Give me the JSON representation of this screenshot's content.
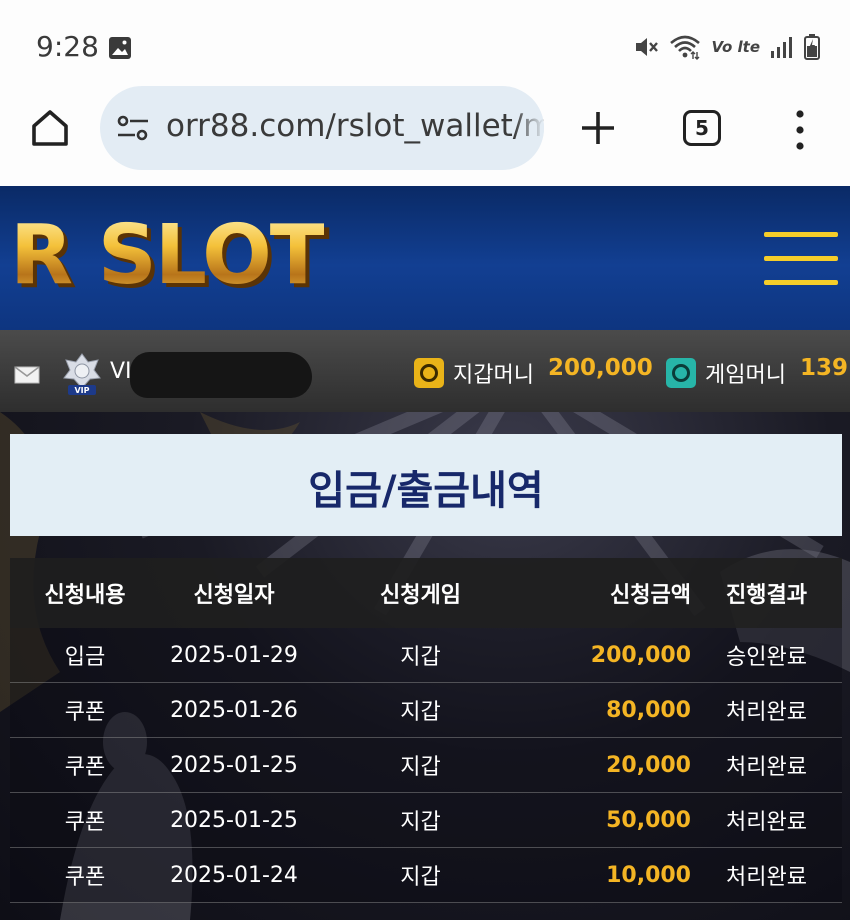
{
  "status_bar": {
    "time": "9:28",
    "lte_label": "Vo lte"
  },
  "browser": {
    "url": "orr88.com/rslot_wallet/m",
    "tab_count": "5"
  },
  "site": {
    "logo": "R SLOT"
  },
  "user": {
    "vip_prefix": "VI",
    "wallet_label": "지갑머니",
    "wallet_value": "200,000",
    "game_label": "게임머니",
    "game_value": "139"
  },
  "page": {
    "title": "입금/출금내역"
  },
  "table": {
    "headers": [
      "신청내용",
      "신청일자",
      "신청게임",
      "신청금액",
      "진행결과"
    ],
    "rows": [
      {
        "type": "입금",
        "date": "2025-01-29",
        "game": "지갑",
        "amount": "200,000",
        "result": "승인완료"
      },
      {
        "type": "쿠폰",
        "date": "2025-01-26",
        "game": "지갑",
        "amount": "80,000",
        "result": "처리완료"
      },
      {
        "type": "쿠폰",
        "date": "2025-01-25",
        "game": "지갑",
        "amount": "20,000",
        "result": "처리완료"
      },
      {
        "type": "쿠폰",
        "date": "2025-01-25",
        "game": "지갑",
        "amount": "50,000",
        "result": "처리완료"
      },
      {
        "type": "쿠폰",
        "date": "2025-01-24",
        "game": "지갑",
        "amount": "10,000",
        "result": "처리완료"
      }
    ]
  },
  "colors": {
    "header_blue": "#123f92",
    "gold": "#f4b524",
    "hamburger": "#f5cd2a",
    "title_text": "#17286a"
  },
  "icons": [
    "image-icon",
    "mute-icon",
    "wifi-icon",
    "signal-icon",
    "battery-icon",
    "home-icon",
    "tune-icon",
    "plus-icon",
    "more-vert-icon",
    "hamburger-menu-icon",
    "mail-icon",
    "vip-badge-icon",
    "wallet-safe-icon",
    "game-safe-icon"
  ]
}
